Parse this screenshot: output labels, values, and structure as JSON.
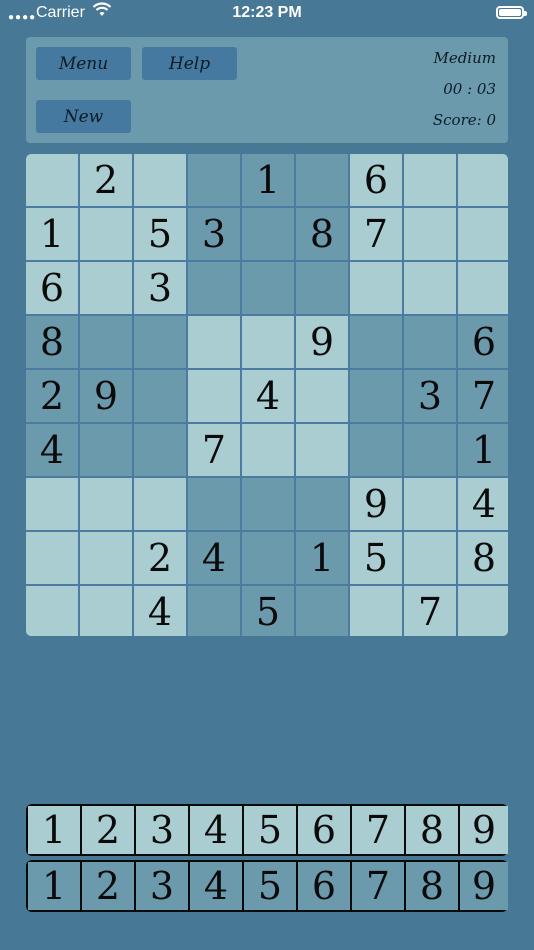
{
  "status_bar": {
    "carrier": "Carrier",
    "time": "12:23 PM"
  },
  "controls": {
    "menu_label": "Menu",
    "help_label": "Help",
    "new_label": "New"
  },
  "game_info": {
    "difficulty": "Medium",
    "timer": "00 : 03",
    "score": "Score: 0"
  },
  "grid": [
    [
      "",
      "2",
      "",
      "",
      "1",
      "",
      "6",
      "",
      ""
    ],
    [
      "1",
      "",
      "5",
      "3",
      "",
      "8",
      "7",
      "",
      ""
    ],
    [
      "6",
      "",
      "3",
      "",
      "",
      "",
      "",
      "",
      ""
    ],
    [
      "8",
      "",
      "",
      "",
      "",
      "9",
      "",
      "",
      "6"
    ],
    [
      "2",
      "9",
      "",
      "",
      "4",
      "",
      "",
      "3",
      "7"
    ],
    [
      "4",
      "",
      "",
      "7",
      "",
      "",
      "",
      "",
      "1"
    ],
    [
      "",
      "",
      "",
      "",
      "",
      "",
      "9",
      "",
      "4"
    ],
    [
      "",
      "",
      "2",
      "4",
      "",
      "1",
      "5",
      "",
      "8"
    ],
    [
      "",
      "",
      "4",
      "",
      "5",
      "",
      "",
      "7",
      ""
    ]
  ],
  "number_pad_top": [
    "1",
    "2",
    "3",
    "4",
    "5",
    "6",
    "7",
    "8",
    "9"
  ],
  "number_pad_bottom": [
    "1",
    "2",
    "3",
    "4",
    "5",
    "6",
    "7",
    "8",
    "9"
  ]
}
